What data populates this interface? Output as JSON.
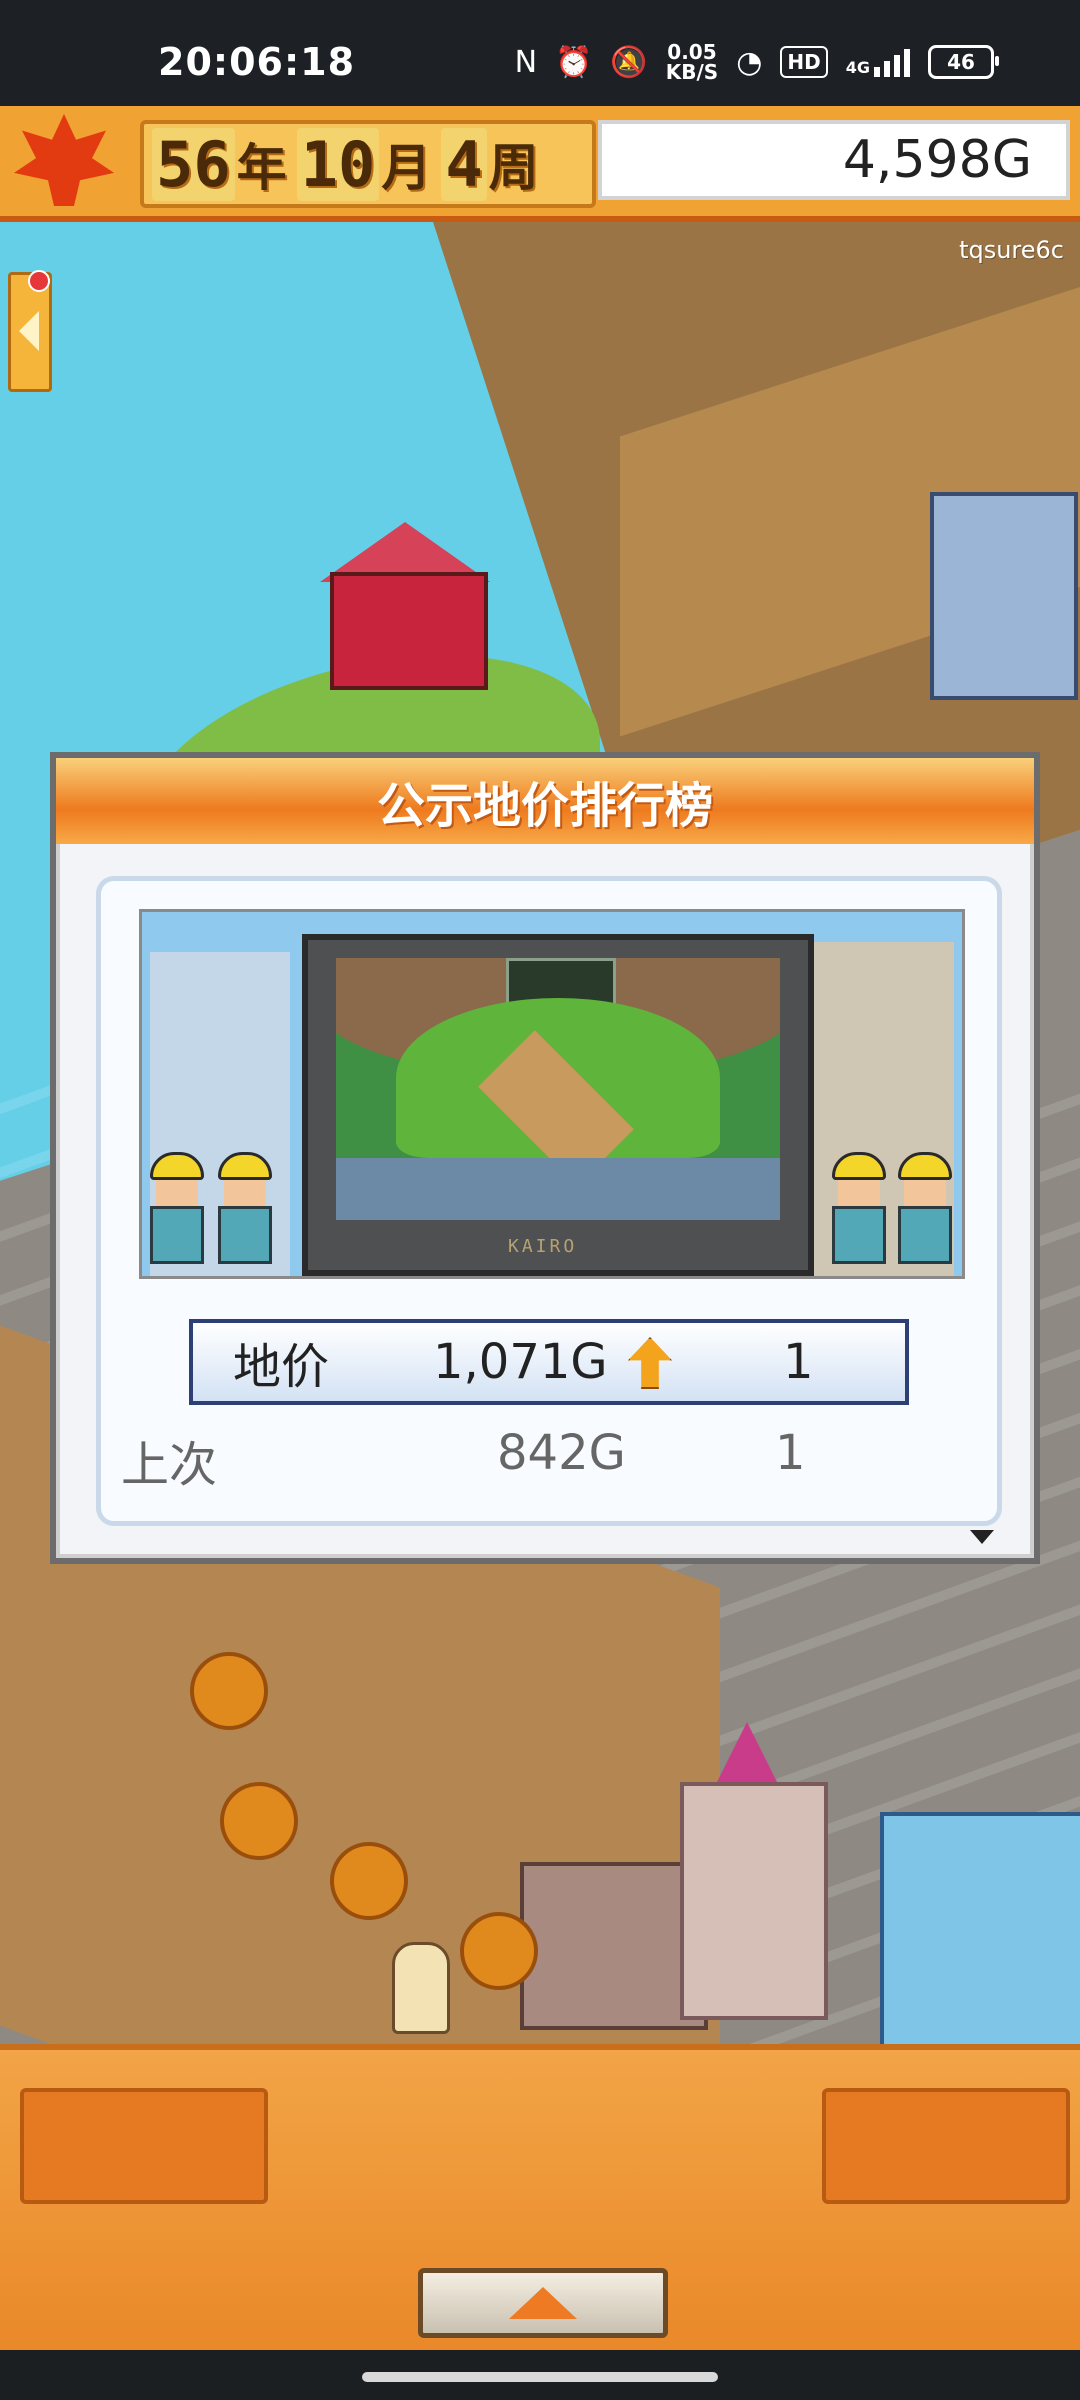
{
  "status_bar": {
    "time": "20:06:18",
    "net_speed_value": "0.05",
    "net_speed_unit": "KB/S",
    "hd_label": "HD",
    "network_type": "4G",
    "battery": "46"
  },
  "top_bar": {
    "year": "56",
    "year_unit": "年",
    "month": "10",
    "month_unit": "月",
    "week": "4",
    "week_unit": "周",
    "money": "4,598G"
  },
  "map": {
    "user_tag": "tqsure6c"
  },
  "dialog": {
    "title": "公示地价排行榜",
    "tv_brand": "KAIRO",
    "price_row": {
      "label": "地价",
      "value": "1,071G",
      "rank": "1",
      "trend": "up"
    },
    "previous_row": {
      "label": "上次",
      "value": "842G",
      "rank": "1"
    }
  },
  "bottom_panel": {
    "expand_icon": "triangle-up-icon"
  }
}
